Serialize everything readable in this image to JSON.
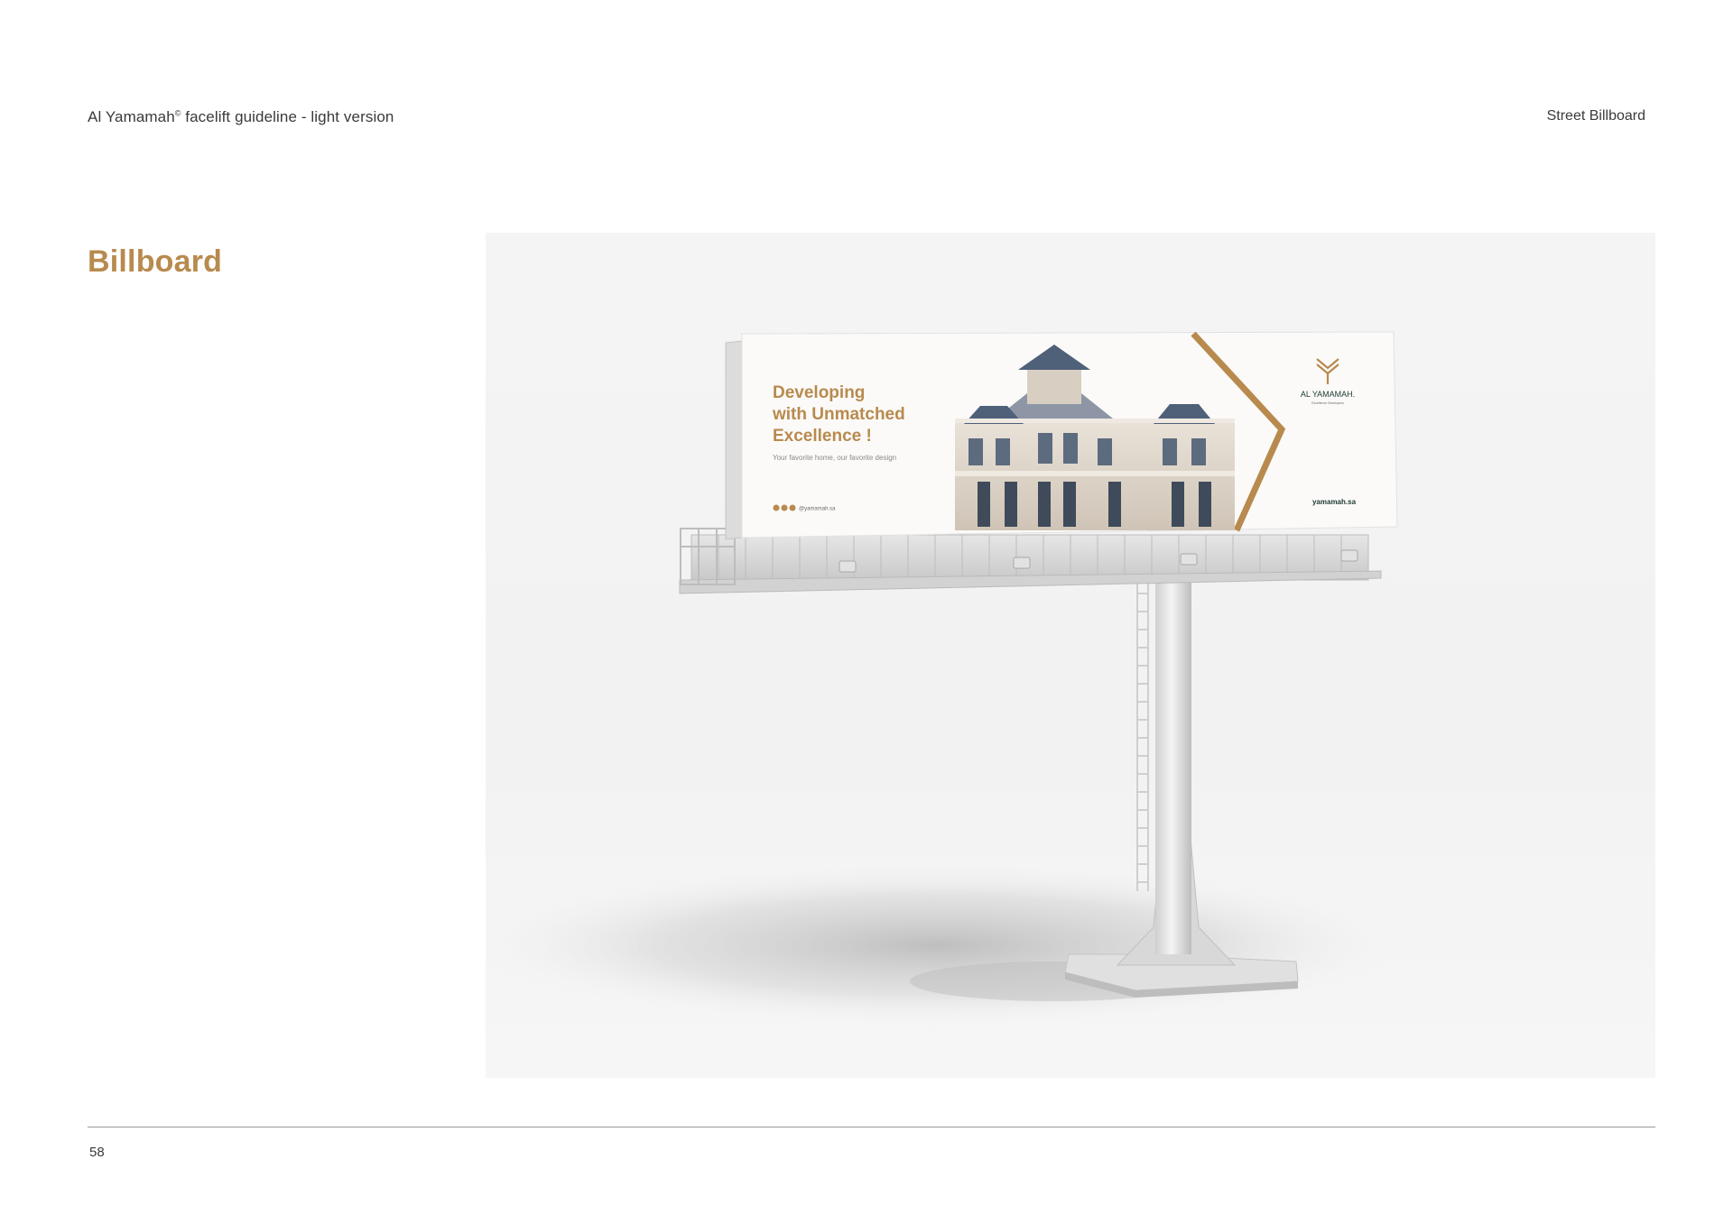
{
  "header": {
    "doc_title": "Al Yamamah",
    "registered_mark": "©",
    "doc_subtitle": " facelift guideline - light version",
    "section": "Street Billboard"
  },
  "page": {
    "title": "Billboard",
    "number": "58"
  },
  "billboard": {
    "headline_line1": "Developing",
    "headline_line2": "with Unmatched",
    "headline_line3": "Excellence !",
    "tagline": "Your favorite home, our favorite design",
    "social_handle": "@yamamah.sa",
    "brand_name": "AL YAMAMAH.",
    "brand_sub": "Excellence Developers",
    "website": "yamamah.sa"
  },
  "colors": {
    "accent_gold": "#b88a4e",
    "text_dark": "#3a3a3a",
    "brand_green": "#1e3a33"
  }
}
